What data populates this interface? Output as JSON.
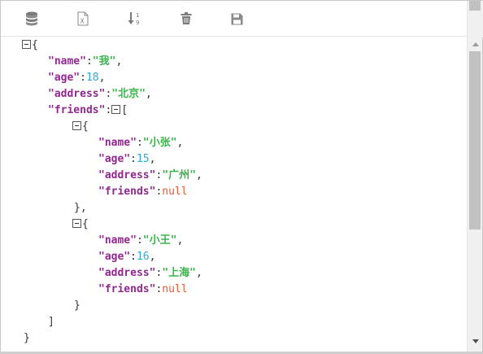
{
  "toolbar": {
    "buttons": [
      {
        "icon": "database-icon"
      },
      {
        "icon": "excel-file-icon"
      },
      {
        "icon": "sort-icon"
      },
      {
        "icon": "trash-icon"
      },
      {
        "icon": "save-icon"
      }
    ]
  },
  "editor": {
    "lines": [
      {
        "o": "{"
      },
      {
        "k": "\"name\"",
        "v": "\"我\"",
        "vt": "string",
        "t": ","
      },
      {
        "k": "\"age\"",
        "v": "18",
        "vt": "number",
        "t": ","
      },
      {
        "k": "\"address\"",
        "v": "\"北京\"",
        "vt": "string",
        "t": ","
      },
      {
        "k": "\"friends\"",
        "o": "["
      },
      {
        "o": "{"
      },
      {
        "k": "\"name\"",
        "v": "\"小张\"",
        "vt": "string",
        "t": ","
      },
      {
        "k": "\"age\"",
        "v": "15",
        "vt": "number",
        "t": ","
      },
      {
        "k": "\"address\"",
        "v": "\"广州\"",
        "vt": "string",
        "t": ","
      },
      {
        "k": "\"friends\"",
        "v": "null",
        "vt": "null",
        "t": ""
      },
      {
        "c": "},"
      },
      {
        "o": "{"
      },
      {
        "k": "\"name\"",
        "v": "\"小王\"",
        "vt": "string",
        "t": ","
      },
      {
        "k": "\"age\"",
        "v": "16",
        "vt": "number",
        "t": ","
      },
      {
        "k": "\"address\"",
        "v": "\"上海\"",
        "vt": "string",
        "t": ","
      },
      {
        "k": "\"friends\"",
        "v": "null",
        "vt": "null",
        "t": ""
      },
      {
        "c": "}"
      },
      {
        "c": "]"
      },
      {
        "c": "}"
      }
    ]
  },
  "colors": {
    "key": "#92278f",
    "string": "#3ab54a",
    "number": "#25aae2",
    "null": "#f1592a"
  }
}
